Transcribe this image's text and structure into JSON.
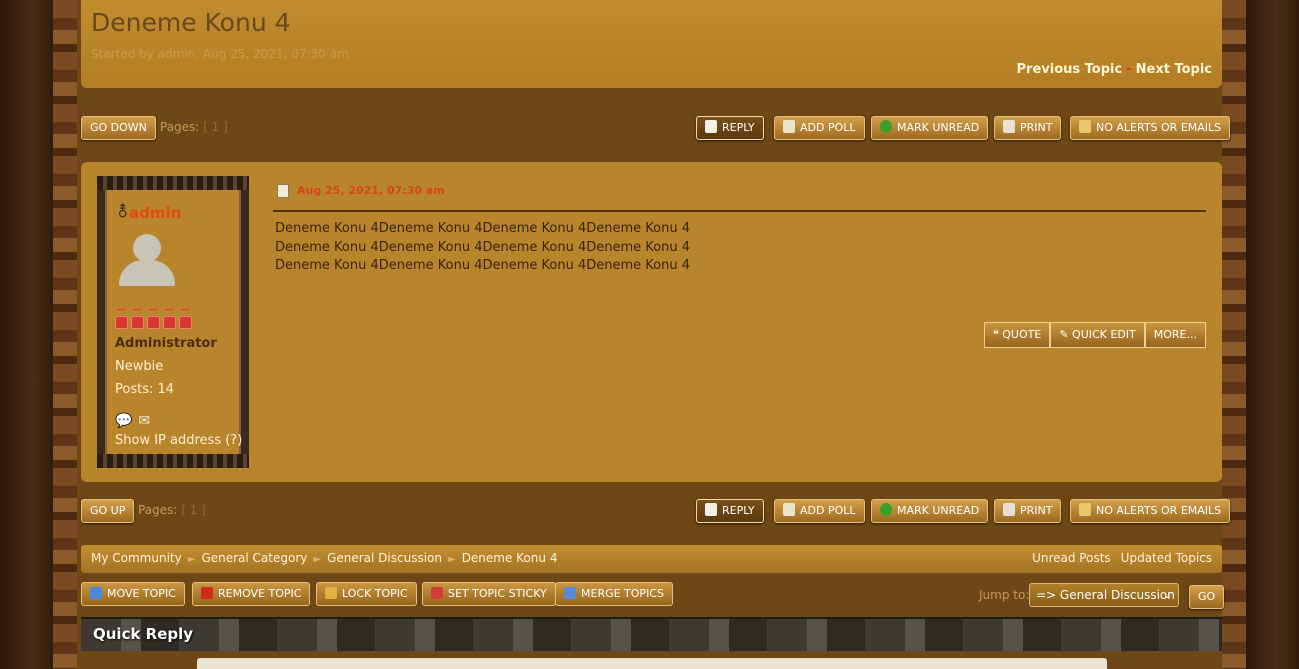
{
  "topic": {
    "title": "Deneme Konu 4",
    "started_by": "Started by admin, Aug 25, 2021, 07:30 am",
    "previous": "Previous Topic",
    "separator": "-",
    "next": "Next Topic"
  },
  "nav_top": {
    "go_down": "GO DOWN",
    "pages_label": "Pages:",
    "pages_value": "[ 1 ]"
  },
  "nav_bottom": {
    "go_up": "GO UP",
    "pages_label": "Pages:",
    "pages_value": "[ 1 ]"
  },
  "actions": {
    "reply": "REPLY",
    "add_poll": "ADD POLL",
    "mark_unread": "MARK UNREAD",
    "print": "PRINT",
    "no_alerts": "NO ALERTS OR EMAILS"
  },
  "post": {
    "author": "admin",
    "rank": "Administrator",
    "membergroup": "Newbie",
    "posts": "Posts: 14",
    "show_ip": "Show IP address (?)",
    "date": "Aug 25, 2021, 07:30 am",
    "body_lines": [
      "Deneme Konu 4Deneme Konu 4Deneme Konu 4Deneme Konu 4",
      "Deneme Konu 4Deneme Konu 4Deneme Konu 4Deneme Konu 4",
      "Deneme Konu 4Deneme Konu 4Deneme Konu 4Deneme Konu 4"
    ],
    "quote": "QUOTE",
    "quick_edit": "QUICK EDIT",
    "more": "MORE..."
  },
  "breadcrumb": {
    "items": [
      "My Community",
      "General Category",
      "General Discussion",
      "Deneme Konu 4"
    ],
    "arrow": "►",
    "unread_posts": "Unread Posts",
    "updated_topics": "Updated Topics"
  },
  "moderation": {
    "move": "MOVE TOPIC",
    "remove": "REMOVE TOPIC",
    "lock": "LOCK TOPIC",
    "sticky": "SET TOPIC STICKY",
    "merge": "MERGE TOPICS"
  },
  "jump": {
    "label": "Jump to:",
    "selected": "=> General Discussion",
    "go": "GO"
  },
  "quick_reply": {
    "title": "Quick Reply"
  },
  "colors": {
    "header_gold": "#c18d2e",
    "author_red": "#e24a10",
    "button_gold": "#d2a04a"
  }
}
